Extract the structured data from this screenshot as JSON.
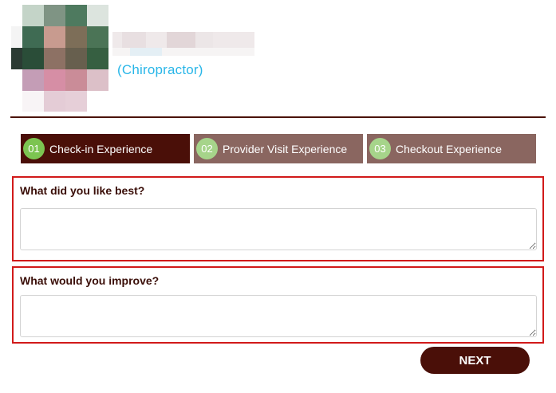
{
  "provider": {
    "specialty": "(Chiropractor)"
  },
  "steps": [
    {
      "number": "01",
      "label": "Check-in Experience",
      "active": true
    },
    {
      "number": "02",
      "label": "Provider Visit Experience",
      "active": false
    },
    {
      "number": "03",
      "label": "Checkout Experience",
      "active": false
    }
  ],
  "questions": {
    "liked_label": "What did you like best?",
    "liked_value": "",
    "improve_label": "What would you improve?",
    "improve_value": ""
  },
  "actions": {
    "next_label": "NEXT"
  },
  "colors": {
    "brand_dark": "#4a0f08",
    "step_inactive": "#8a6660",
    "step_badge_active": "#7cc451",
    "step_badge_inactive": "#a6d48a",
    "specialty_text": "#29b6e8",
    "question_border": "#d11a1a"
  }
}
